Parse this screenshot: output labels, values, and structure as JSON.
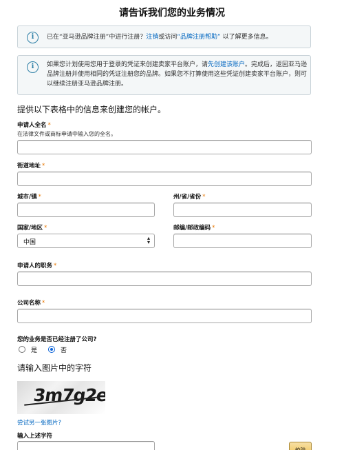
{
  "page": {
    "title": "请告诉我们您的业务情况"
  },
  "alerts": {
    "first": {
      "prefix": "已在“亚马逊品牌注册”中进行注册？",
      "logout_link": "注销",
      "middle": "或访问",
      "help_link": "“品牌注册帮助”",
      "suffix": "以了解更多信息。"
    },
    "second": {
      "prefix": "如果您计划使用您用于登录的凭证来创建卖家平台账户，请",
      "create_link": "先创建该账户",
      "suffix": "。完成后，返回亚马逊品牌注册并使用相同的凭证注册您的品牌。如果您不打算使用这些凭证创建卖家平台账户，则可以继续注册亚马逊品牌注册。"
    }
  },
  "form": {
    "section_heading": "提供以下表格中的信息来创建您的帐户。",
    "required_mark": "*",
    "applicant_name": {
      "label": "申请人全名",
      "hint": "在法律文件或商标申请中输入您的全名。",
      "value": ""
    },
    "street": {
      "label": "街道地址",
      "value": ""
    },
    "city": {
      "label": "城市/镇",
      "value": ""
    },
    "state": {
      "label": "州/省/省份",
      "value": ""
    },
    "country": {
      "label": "国家/地区",
      "selected": "中国"
    },
    "postal": {
      "label": "邮编/邮政编码",
      "value": ""
    },
    "job_title": {
      "label": "申请人的职务",
      "value": ""
    },
    "company": {
      "label": "公司名称",
      "value": ""
    },
    "registered": {
      "question": "您的业务是否已经注册了公司?",
      "options": [
        "是",
        "否"
      ],
      "selected": "否"
    }
  },
  "captcha": {
    "heading": "请输入图片中的字符",
    "image_text": "3m7g2e",
    "retry_link": "尝试另一张图片?",
    "input_label": "输入上述字符",
    "value": ""
  },
  "buttons": {
    "verify": "校验"
  },
  "colors": {
    "link": "#0066c0",
    "required": "#e77600",
    "info_icon": "#2d7fa6",
    "button": "#f0c14b"
  },
  "icons": {
    "info": "info-circle-icon",
    "select_arrows": "updown-chevron-icon"
  }
}
